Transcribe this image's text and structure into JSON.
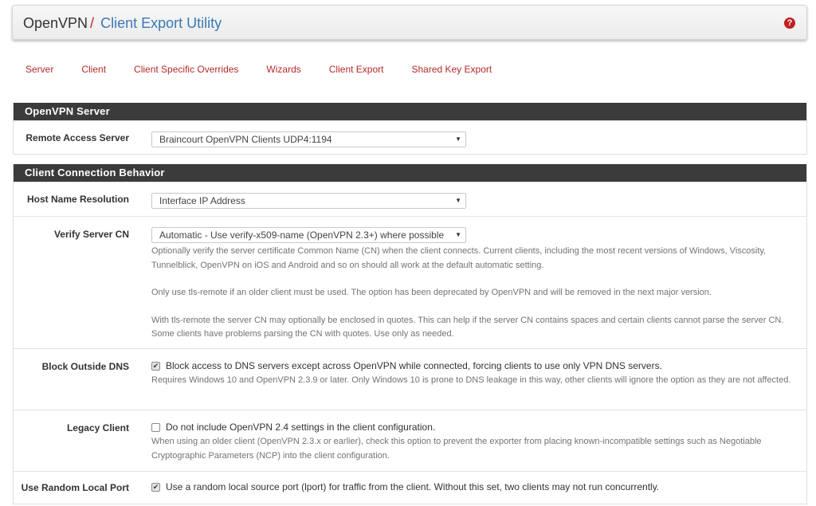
{
  "breadcrumb": {
    "parent": "OpenVPN",
    "separator": "/",
    "current": "Client Export Utility",
    "help_icon": "question-circle-icon"
  },
  "tabs": [
    "Server",
    "Client",
    "Client Specific Overrides",
    "Wizards",
    "Client Export",
    "Shared Key Export"
  ],
  "server_panel": {
    "heading": "OpenVPN Server",
    "remote_access": {
      "label": "Remote Access Server",
      "value": "Braincourt OpenVPN Clients UDP4:1194"
    }
  },
  "behavior_panel": {
    "heading": "Client Connection Behavior",
    "host_name": {
      "label": "Host Name Resolution",
      "value": "Interface IP Address"
    },
    "verify_cn": {
      "label": "Verify Server CN",
      "value": "Automatic - Use verify-x509-name (OpenVPN 2.3+) where possible",
      "help1": "Optionally verify the server certificate Common Name (CN) when the client connects. Current clients, including the most recent versions of Windows, Viscosity, Tunnelblick, OpenVPN on iOS and Android and so on should all work at the default automatic setting.",
      "help2": "Only use tls-remote if an older client must be used. The option has been deprecated by OpenVPN and will be removed in the next major version.",
      "help3": "With tls-remote the server CN may optionally be enclosed in quotes. This can help if the server CN contains spaces and certain clients cannot parse the server CN. Some clients have problems parsing the CN with quotes. Use only as needed."
    },
    "block_dns": {
      "label": "Block Outside DNS",
      "checked": true,
      "text": "Block access to DNS servers except across OpenVPN while connected, forcing clients to use only VPN DNS servers.",
      "help": "Requires Windows 10 and OpenVPN 2.3.9 or later. Only Windows 10 is prone to DNS leakage in this way, other clients will ignore the option as they are not affected."
    },
    "legacy": {
      "label": "Legacy Client",
      "checked": false,
      "text": "Do not include OpenVPN 2.4 settings in the client configuration.",
      "help": "When using an older client (OpenVPN 2.3.x or earlier), check this option to prevent the exporter from placing known-incompatible settings such as Negotiable Cryptographic Parameters (NCP) into the client configuration."
    },
    "random_port": {
      "label": "Use Random Local Port",
      "checked": true,
      "text": "Use a random local source port (lport) for traffic from the client. Without this set, two clients may not run concurrently."
    }
  }
}
